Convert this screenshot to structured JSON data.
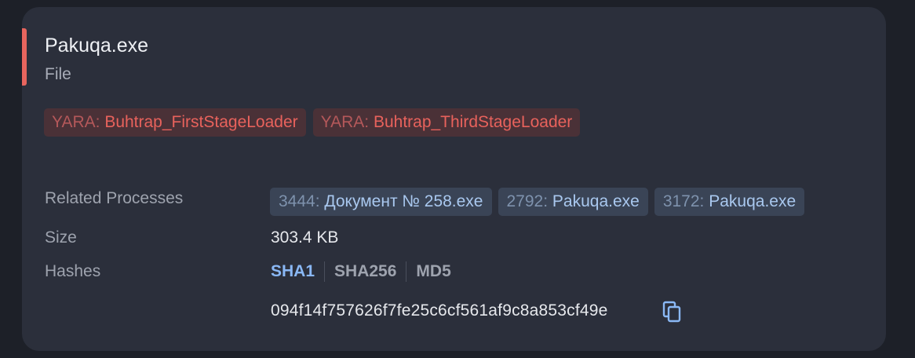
{
  "file": {
    "name": "Pakuqa.exe",
    "type": "File"
  },
  "yara": [
    {
      "prefix": "YARA:",
      "rule": "Buhtrap_FirstStageLoader"
    },
    {
      "prefix": "YARA:",
      "rule": "Buhtrap_ThirdStageLoader"
    }
  ],
  "labels": {
    "related_processes": "Related Processes",
    "size": "Size",
    "hashes": "Hashes"
  },
  "related_processes": [
    {
      "pid": "3444:",
      "name": "Документ № 258.exe"
    },
    {
      "pid": "2792:",
      "name": "Pakuqa.exe"
    },
    {
      "pid": "3172:",
      "name": "Pakuqa.exe"
    }
  ],
  "size": "303.4 KB",
  "hash_tabs": [
    "SHA1",
    "SHA256",
    "MD5"
  ],
  "active_hash_tab": "SHA1",
  "hash_value": "094f14f757626f7fe25c6cf561af9c8a853cf49e",
  "colors": {
    "accent": "#e8655e",
    "yara_text": "#e8625c",
    "process_text": "#a9c8ef",
    "active_tab": "#8ab8f5"
  },
  "icons": {
    "copy": "copy-icon"
  }
}
